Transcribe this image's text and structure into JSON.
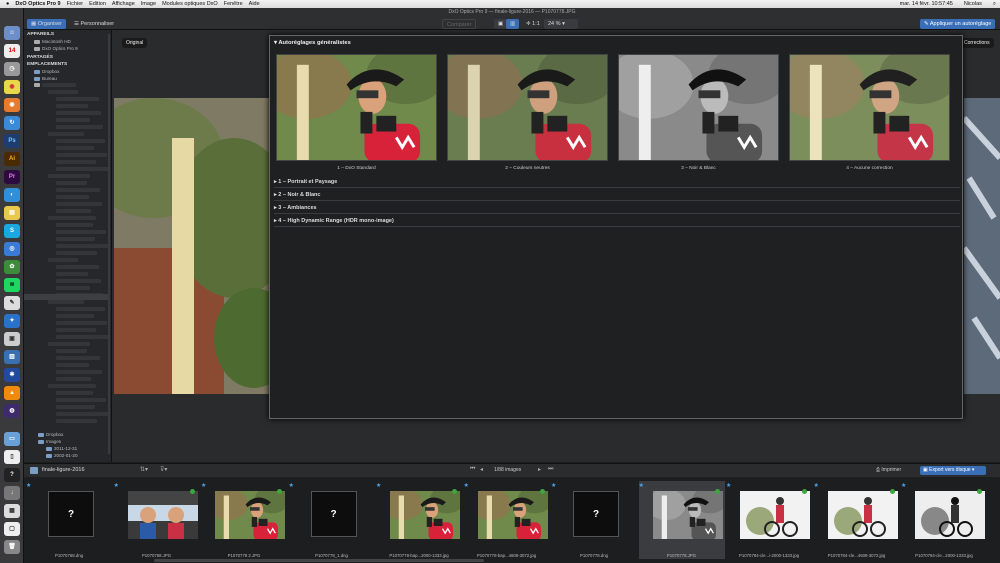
{
  "menubar": {
    "app": "DxO Optics Pro 9",
    "items": [
      "Fichier",
      "Edition",
      "Affichage",
      "Image",
      "Modules optiques DxO",
      "Fenêtre",
      "Aide"
    ],
    "datetime": "mar. 14 févr.  10:57:45",
    "user": "Nicolas"
  },
  "toolbar": {
    "window_title": "DxO Optics Pro 9 — finale-ligure-2016 — P1070778.JPG",
    "tab_organize": "Organiser",
    "tab_customize": "Personnaliser",
    "compare": "Comparer",
    "zoom_fit": "1:1",
    "zoom_level": "24 %",
    "apply_preset": "Appliquer un autoréglage"
  },
  "sidebar": {
    "section_devices": "APPAREILS",
    "devices": [
      "Macintosh HD",
      "DxO Optics Pro 9"
    ],
    "section_shared": "PARTAGÉS",
    "section_locations": "EMPLACEMENTS",
    "locations": [
      "Dropbox",
      "Bureau"
    ],
    "bottom_items": [
      "Dropbox",
      "Images",
      "2011-12-31",
      "2002-01-20"
    ]
  },
  "viewer": {
    "original_label": "Original",
    "corrections_label": "Corrections"
  },
  "presets": {
    "title": "Autoréglages généralistes",
    "thumbs": [
      {
        "caption": "1 – DxO Standard",
        "style": "color"
      },
      {
        "caption": "2 – Couleurs neutres",
        "style": "neutral"
      },
      {
        "caption": "3 – Noir & Blanc",
        "style": "bw"
      },
      {
        "caption": "4 – Aucune correction",
        "style": "flat"
      }
    ],
    "groups": [
      "1 – Portrait et Paysage",
      "2 – Noir & Blanc",
      "3 – Ambiances",
      "4 – High Dynamic Range (HDR mono-image)"
    ]
  },
  "filmstrip": {
    "folder": "finale-ligure-2016",
    "count": "1/88 images",
    "print": "Imprimer",
    "export": "Export vers disque",
    "items": [
      {
        "name": "P1070768.dng",
        "kind": "missing"
      },
      {
        "name": "P1070768.JPG",
        "kind": "car"
      },
      {
        "name": "P1070778 2.JPG",
        "kind": "rider"
      },
      {
        "name": "P1070778_1.dng",
        "kind": "missing"
      },
      {
        "name": "P1070778-bap...2000-1333.jpg",
        "kind": "rider"
      },
      {
        "name": "P1070778-bap...4608-3072.jpg",
        "kind": "rider"
      },
      {
        "name": "P1070778.dng",
        "kind": "missing"
      },
      {
        "name": "P1070778.JPG",
        "kind": "bw",
        "selected": true
      },
      {
        "name": "P1070784-cle...i-2000-1333.jpg",
        "kind": "bike"
      },
      {
        "name": "P1070784-cle...4608-3072.jpg",
        "kind": "bike"
      },
      {
        "name": "P1070784-cle...2000-1333.jpg",
        "kind": "bikebw"
      }
    ]
  }
}
